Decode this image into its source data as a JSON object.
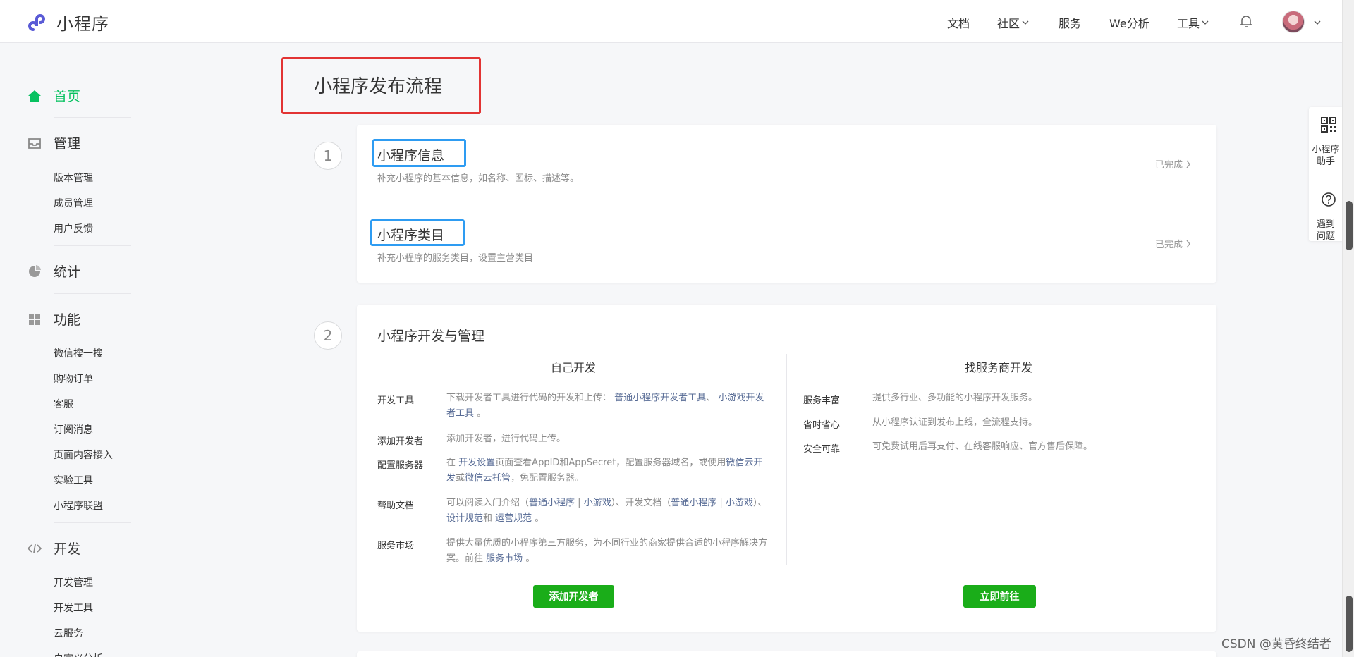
{
  "brand": {
    "name": "小程序"
  },
  "topnav": {
    "docs": "文档",
    "community": "社区",
    "service": "服务",
    "analysis": "We分析",
    "tools": "工具"
  },
  "sidebar": {
    "home": "首页",
    "manage": "管理",
    "manage_items": [
      "版本管理",
      "成员管理",
      "用户反馈"
    ],
    "stats": "统计",
    "features": "功能",
    "feature_items": [
      "微信搜一搜",
      "购物订单",
      "客服",
      "订阅消息",
      "页面内容接入",
      "实验工具",
      "小程序联盟"
    ],
    "develop": "开发",
    "develop_items": [
      "开发管理",
      "开发工具",
      "云服务",
      "自定义分析"
    ]
  },
  "page": {
    "title": "小程序发布流程"
  },
  "steps": [
    {
      "number": "1",
      "items": [
        {
          "title": "小程序信息",
          "desc": "补充小程序的基本信息，如名称、图标、描述等。",
          "status": "已完成"
        },
        {
          "title": "小程序类目",
          "desc": "补充小程序的服务类目，设置主营类目",
          "status": "已完成"
        }
      ]
    },
    {
      "number": "2",
      "title": "小程序开发与管理",
      "self_dev": {
        "heading": "自己开发",
        "rows": [
          {
            "label": "开发工具",
            "text1": "下载开发者工具进行代码的开发和上传：",
            "link1": "普通小程序开发者工具",
            "sep": "、",
            "link2": "小游戏开发者工具",
            "text2": "。"
          },
          {
            "label": "添加开发者",
            "text1": "添加开发者，进行代码上传。"
          },
          {
            "label": "配置服务器",
            "text1": "在",
            "link1": "开发设置",
            "text2": "页面查看AppID和AppSecret，配置服务器域名，或使用",
            "link2": "微信云开发",
            "text3": "或",
            "link3": "微信云托管",
            "text4": "，免配置服务器。"
          },
          {
            "label": "帮助文档",
            "text1": "可以阅读入门介绍（",
            "link1": "普通小程序",
            "sep1": "|",
            "link2": "小游戏",
            "text2": "）、开发文档（",
            "link3": "普通小程序",
            "sep2": "|",
            "link4": "小游戏",
            "text3": "）、",
            "link5": "设计规范",
            "text4": "和",
            "link6": "运营规范",
            "text5": "。"
          },
          {
            "label": "服务市场",
            "text1": "提供大量优质的小程序第三方服务，为不同行业的商家提供合适的小程序解决方案。前往",
            "link1": "服务市场",
            "text2": "。"
          }
        ],
        "button": "添加开发者"
      },
      "vendor_dev": {
        "heading": "找服务商开发",
        "rows": [
          {
            "label": "服务丰富",
            "text": "提供多行业、多功能的小程序开发服务。"
          },
          {
            "label": "省时省心",
            "text": "从小程序认证到发布上线，全流程支持。"
          },
          {
            "label": "安全可靠",
            "text": "可免费试用后再支付、在线客服响应、官方售后保障。"
          }
        ],
        "button": "立即前往"
      }
    }
  ],
  "float_panel": {
    "assistant": [
      "小程序",
      "助手"
    ],
    "help": [
      "遇到",
      "问题"
    ]
  },
  "watermark": "CSDN @黄昏终结者",
  "colors": {
    "accent": "#07c160",
    "link": "#576b95",
    "button": "#1aad19",
    "highlight_red": "#e23434",
    "highlight_blue": "#2e9cf2"
  }
}
